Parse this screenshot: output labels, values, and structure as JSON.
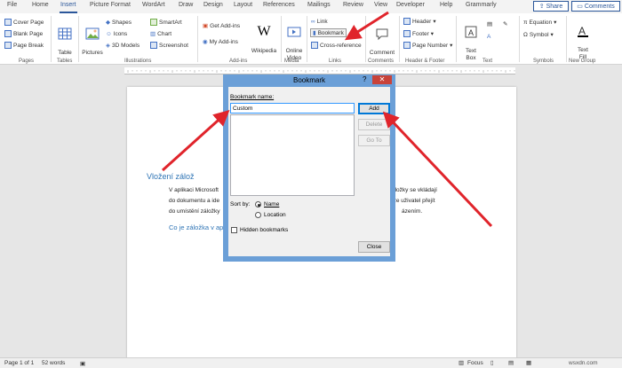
{
  "tabs": [
    "File",
    "Home",
    "Insert",
    "Picture Format",
    "WordArt",
    "Draw",
    "Design",
    "Layout",
    "References",
    "Mailings",
    "Review",
    "View",
    "Developer",
    "Help",
    "Grammarly"
  ],
  "active_tab": "Insert",
  "header_buttons": {
    "share": "Share",
    "comments": "Comments"
  },
  "ribbon": {
    "pages": {
      "label": "Pages",
      "items": [
        "Cover Page",
        "Blank Page",
        "Page Break"
      ]
    },
    "tables": {
      "label": "Tables",
      "table": "Table"
    },
    "illustrations": {
      "label": "Illustrations",
      "pictures": "Pictures",
      "shapes": "Shapes",
      "icons": "Icons",
      "models": "3D Models",
      "smartart": "SmartArt",
      "chart": "Chart",
      "screenshot": "Screenshot"
    },
    "addins": {
      "label": "Add-ins",
      "get": "Get Add-ins",
      "my": "My Add-ins",
      "wikipedia": "Wikipedia"
    },
    "media": {
      "label": "Media",
      "online_video": "Online\nVideo"
    },
    "links": {
      "label": "Links",
      "link": "Link",
      "bookmark": "Bookmark",
      "cross_reference": "Cross-reference"
    },
    "comments": {
      "label": "Comments",
      "comment": "Comment"
    },
    "header_footer": {
      "label": "Header & Footer",
      "header": "Header",
      "footer": "Footer",
      "page_number": "Page Number"
    },
    "text": {
      "label": "Text",
      "text_box": "Text\nBox"
    },
    "symbols": {
      "label": "Symbols",
      "equation": "Equation",
      "symbol": "Symbol"
    },
    "new_group": {
      "label": "New Group",
      "text_fill": "Text\nFill"
    }
  },
  "document": {
    "heading1": "Vložení zálož",
    "lines": [
      "V aplikaci Microsoft",
      "do dokumentu a ide",
      "do umístění záložky"
    ],
    "right_lines": [
      "Záložky se vkládají",
      "ůže uživatel přejít",
      "ázením."
    ],
    "heading2": "Co je záložka v ap"
  },
  "dialog": {
    "title": "Bookmark",
    "help": "?",
    "close": "✕",
    "name_label": "Bookmark name:",
    "name_value": "Custom",
    "add": "Add",
    "delete": "Delete",
    "goto": "Go To",
    "sort_by": "Sort by:",
    "sort_name": "Name",
    "sort_location": "Location",
    "hidden": "Hidden bookmarks",
    "close_btn": "Close"
  },
  "status": {
    "page": "Page 1 of 1",
    "words": "52 words",
    "focus": "Focus",
    "watermark": "wsxdn.com"
  },
  "colors": {
    "accent": "#2b579a",
    "arrow": "#e0242b",
    "dialog_border": "#6b9fd7"
  }
}
